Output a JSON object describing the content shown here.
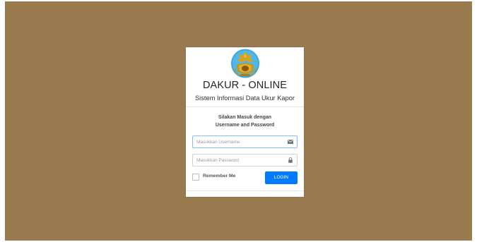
{
  "app": {
    "title": "DAKUR - ONLINE",
    "subtitle": "Sistem Informasi Data Ukur Kapor",
    "logo_icon": "police-emblem-icon"
  },
  "login": {
    "message_line1": "Silakan Masuk dengan",
    "message_line2": "Username and Password",
    "username": {
      "value": "",
      "placeholder": "Masukkan Username",
      "icon": "envelope-icon"
    },
    "password": {
      "value": "",
      "placeholder": "Masukkan Password",
      "icon": "lock-icon"
    },
    "remember_label": "Remember Me",
    "remember_checked": false,
    "submit_label": "LOGIN"
  },
  "colors": {
    "background": "#9a7b50",
    "card": "#ffffff",
    "primary": "#007bff",
    "logo_blue": "#3aa8e0",
    "logo_gold": "#d9a21b"
  }
}
